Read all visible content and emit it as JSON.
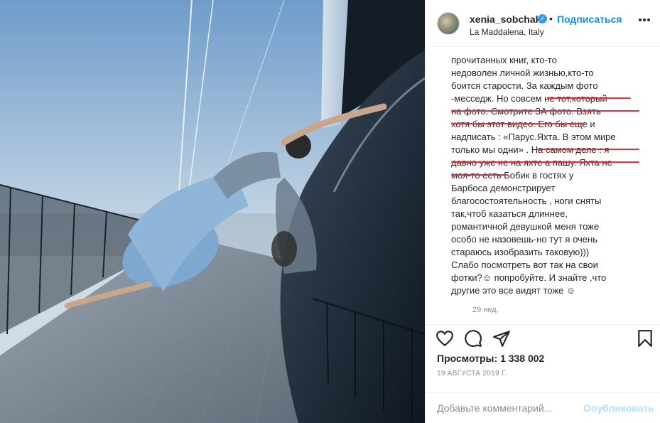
{
  "post": {
    "username": "xenia_sobchak",
    "follow_label": "Подписаться",
    "separator": "•",
    "location": "La Maddalena, Italy",
    "verified_icon": "verified-badge-icon",
    "more_icon": "more-options-icon",
    "caption_lines": [
      "прочитанных книг, кто-то",
      "недоволен личной жизнью,кто-то",
      "боится старости. За каждым фото",
      "-месседж. Но совсем не тот,который",
      "на фото. Смотрите ЗА фото. Взять",
      "хотя бы этот видео. Его бы еще и",
      "надписать : «Парус.Яхта. В этом мире",
      "только мы одни» . На самом деле : я",
      "давно уже не на яхте а пашу. Яхта не",
      "моя-то есть Бобик в гостях у",
      "Барбоса демонстрирует",
      "благосостоятельность , ноги сняты",
      "так,чтоб казаться длиннее,",
      "романтичной девушкой меня тоже",
      "особо не назовешь-но тут я очень",
      "стараюсь изобразить таковую)))",
      "Слабо посмотреть вот так на свои",
      "фотки?☺ попробуйте. И знайте ,что",
      "другие это все видят тоже ☺"
    ],
    "time_ago": "29 нед.",
    "views_label": "Просмотры:",
    "views_count": "1 338 002",
    "date": "19 АВГУСТА 2019 Г.",
    "comment_placeholder": "Добавьте комментарий...",
    "publish_label": "Опубликовать",
    "icons": [
      "heart-icon",
      "comment-icon",
      "share-icon",
      "bookmark-icon"
    ],
    "colors": {
      "accent": "#0095f6",
      "highlight_underline": "#e5323a",
      "publish_disabled": "#b2dffc",
      "muted": "#8e8e8e"
    }
  }
}
